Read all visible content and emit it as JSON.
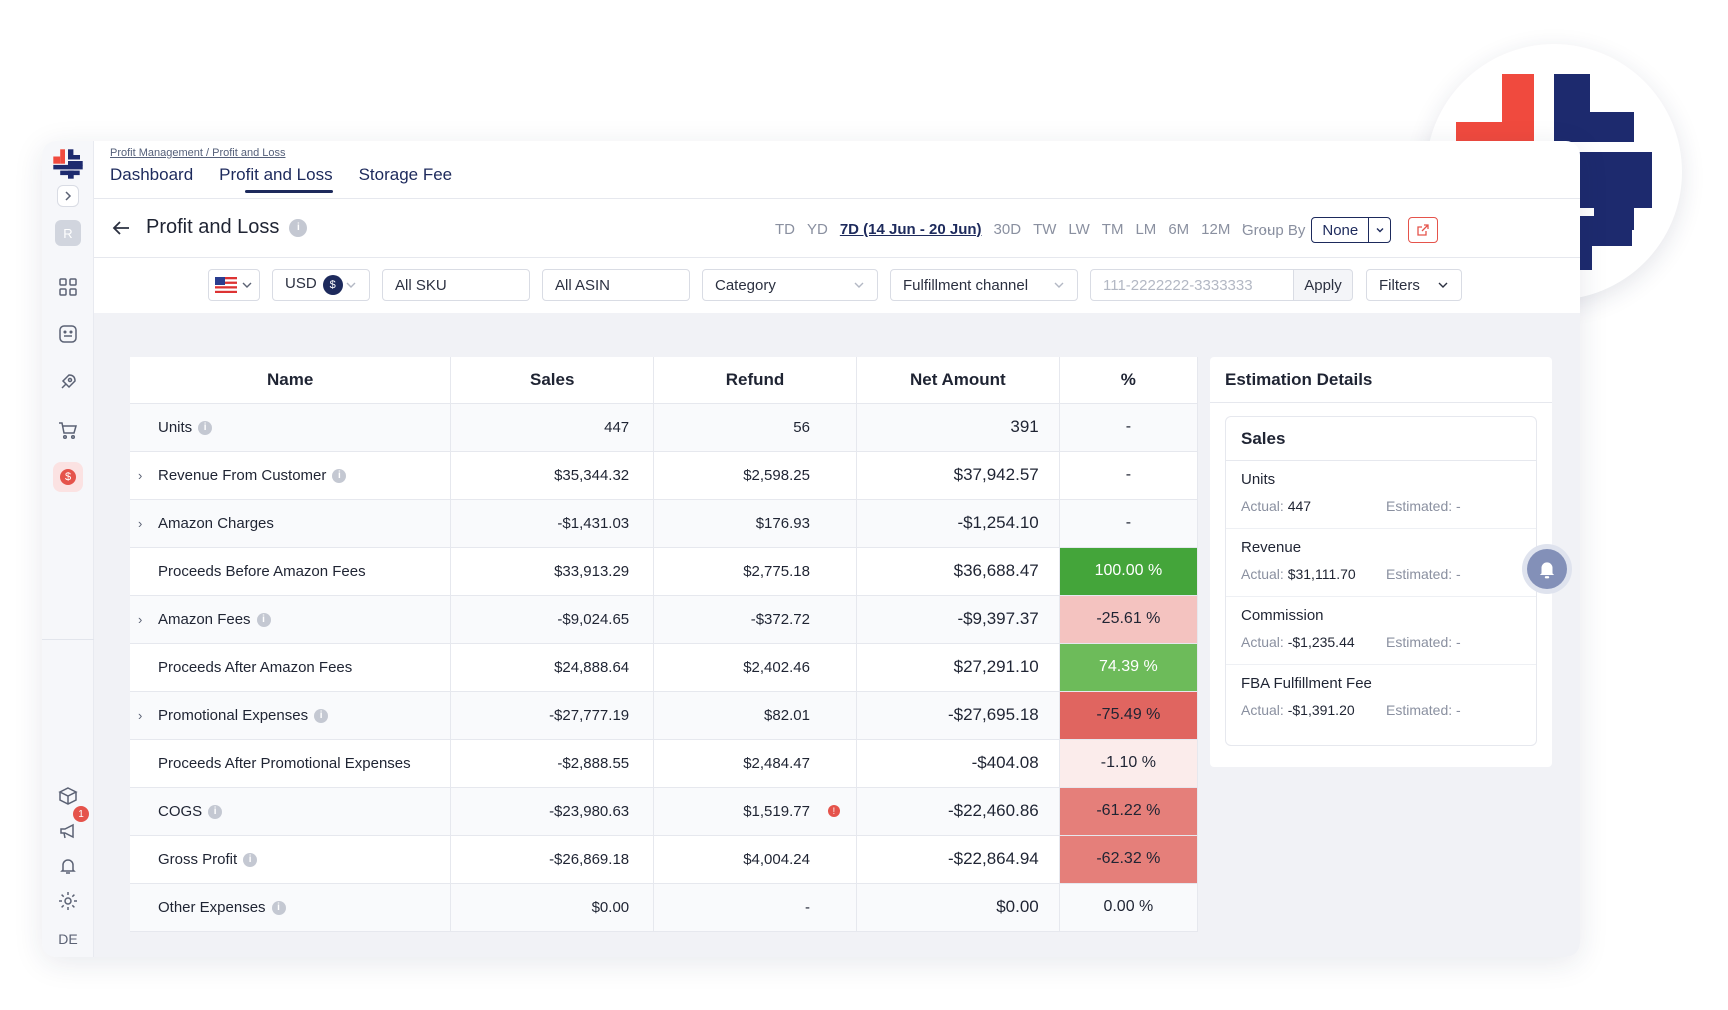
{
  "breadcrumb": "Profit Management / Profit and Loss",
  "tabs": [
    "Dashboard",
    "Profit and Loss",
    "Storage Fee"
  ],
  "active_tab": "Profit and Loss",
  "page_title": "Profit and Loss",
  "periods": [
    "TD",
    "YD",
    "7D (14 Jun - 20 Jun)",
    "30D",
    "TW",
    "LW",
    "TM",
    "LM",
    "6M",
    "12M",
    "'"
  ],
  "active_period": "7D (14 Jun - 20 Jun)",
  "group_by": {
    "label": "Group By",
    "value": "None"
  },
  "sidebar": {
    "user_initial": "R",
    "dollar_label": "$",
    "notification_count": "1",
    "bottom_initials": "DE"
  },
  "filters": {
    "currency": "USD",
    "currency_symbol": "$",
    "sku": "All SKU",
    "asin": "All ASIN",
    "category": "Category",
    "fulfillment": "Fulfillment channel",
    "order_placeholder": "111-2222222-3333333",
    "apply": "Apply",
    "filters": "Filters"
  },
  "table": {
    "headers": [
      "Name",
      "Sales",
      "Refund",
      "Net Amount",
      "%"
    ],
    "rows": [
      {
        "name": "Units",
        "info": true,
        "expandable": false,
        "sales": "447",
        "refund": "56",
        "net": "391",
        "net_tone": "pos",
        "pct": "-",
        "pct_bg": "transparent",
        "pct_color": "#1f2433"
      },
      {
        "name": "Revenue From Customer",
        "info": true,
        "expandable": true,
        "sales": "$35,344.32",
        "refund": "$2,598.25",
        "net": "$37,942.57",
        "net_tone": "pos",
        "pct": "-",
        "pct_bg": "transparent",
        "pct_color": "#1f2433"
      },
      {
        "name": "Amazon Charges",
        "info": false,
        "expandable": true,
        "sales": "-$1,431.03",
        "refund": "$176.93",
        "net": "-$1,254.10",
        "net_tone": "neg",
        "pct": "-",
        "pct_bg": "transparent",
        "pct_color": "#1f2433"
      },
      {
        "name": "Proceeds Before Amazon Fees",
        "info": false,
        "expandable": false,
        "sales": "$33,913.29",
        "refund": "$2,775.18",
        "net": "$36,688.47",
        "net_tone": "pos",
        "pct": "100.00 %",
        "pct_bg": "#44a53a",
        "pct_color": "#ffffff"
      },
      {
        "name": "Amazon Fees",
        "info": true,
        "expandable": true,
        "sales": "-$9,024.65",
        "refund": "-$372.72",
        "net": "-$9,397.37",
        "net_tone": "neg",
        "pct": "-25.61 %",
        "pct_bg": "#f4c3c0",
        "pct_color": "#1f2433"
      },
      {
        "name": "Proceeds After Amazon Fees",
        "info": false,
        "expandable": false,
        "sales": "$24,888.64",
        "refund": "$2,402.46",
        "net": "$27,291.10",
        "net_tone": "pos",
        "pct": "74.39 %",
        "pct_bg": "#6dbb5a",
        "pct_color": "#ffffff"
      },
      {
        "name": "Promotional Expenses",
        "info": true,
        "expandable": true,
        "sales": "-$27,777.19",
        "refund": "$82.01",
        "net": "-$27,695.18",
        "net_tone": "neg",
        "pct": "-75.49 %",
        "pct_bg": "#e06560",
        "pct_color": "#1f2433"
      },
      {
        "name": "Proceeds After Promotional Expenses",
        "info": false,
        "expandable": false,
        "sales": "-$2,888.55",
        "refund": "$2,484.47",
        "net": "-$404.08",
        "net_tone": "neg",
        "pct": "-1.10 %",
        "pct_bg": "#fbeceb",
        "pct_color": "#1f2433"
      },
      {
        "name": "COGS",
        "info": true,
        "expandable": false,
        "sales": "-$23,980.63",
        "refund": "$1,519.77",
        "refund_warning": true,
        "net": "-$22,460.86",
        "net_tone": "neg",
        "pct": "-61.22 %",
        "pct_bg": "#e57f7a",
        "pct_color": "#1f2433"
      },
      {
        "name": "Gross Profit",
        "info": true,
        "expandable": false,
        "sales": "-$26,869.18",
        "refund": "$4,004.24",
        "net": "-$22,864.94",
        "net_tone": "neg",
        "pct": "-62.32 %",
        "pct_bg": "#e57f7a",
        "pct_color": "#1f2433"
      },
      {
        "name": "Other Expenses",
        "info": true,
        "expandable": false,
        "sales": "$0.00",
        "refund": "-",
        "net": "$0.00",
        "net_tone": "plain",
        "pct": "0.00 %",
        "pct_bg": "transparent",
        "pct_color": "#1f2433"
      }
    ]
  },
  "estimation": {
    "title": "Estimation Details",
    "card_title": "Sales",
    "actual_label": "Actual:",
    "estimated_label": "Estimated:",
    "items": [
      {
        "label": "Units",
        "actual": "447",
        "estimated": "-"
      },
      {
        "label": "Revenue",
        "actual": "$31,111.70",
        "estimated": "-"
      },
      {
        "label": "Commission",
        "actual": "-$1,235.44",
        "estimated": "-"
      },
      {
        "label": "FBA Fulfillment Fee",
        "actual": "-$1,391.20",
        "estimated": "-"
      }
    ]
  },
  "colors": {
    "brand_navy": "#1d2a5c",
    "brand_red": "#e5534b",
    "positive": "#1d2a8a",
    "negative": "#e0403a"
  },
  "icons": [
    "logo-icon",
    "chevron-right-icon",
    "user-icon",
    "grid-icon",
    "chat-icon",
    "rocket-icon",
    "cart-icon",
    "dollar-icon",
    "box-icon",
    "megaphone-icon",
    "bell-icon",
    "gear-icon",
    "back-arrow-icon",
    "info-icon",
    "chevron-down-icon",
    "external-link-icon",
    "us-flag-icon"
  ]
}
